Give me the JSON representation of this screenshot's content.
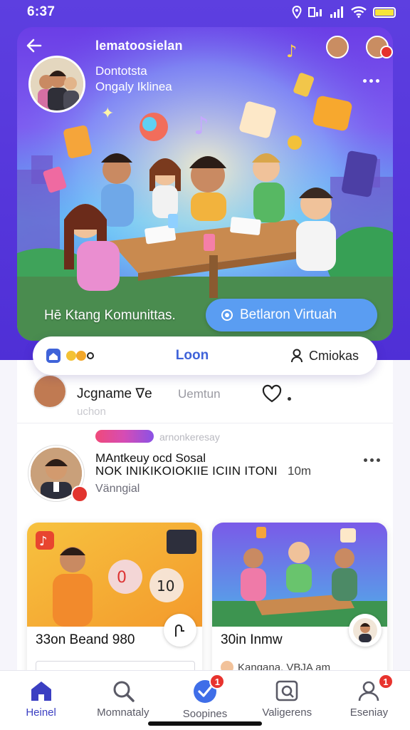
{
  "status": {
    "time": "6:37"
  },
  "hero": {
    "title": "lematoosielan",
    "subtitle_1": "Dontotsta",
    "subtitle_2": "Ongaly Iklinea",
    "caption": "Hē Ktang Komunittas.",
    "virtual_button": "Betlaron Virtuah"
  },
  "pillbar": {
    "left_label": "●●●",
    "center_label": "Loon",
    "right_label": "Cmiokas"
  },
  "feed": {
    "row1": {
      "name": "Jcgname ∇e",
      "meta": "Uemtun",
      "faded": "uchon"
    },
    "row2": {
      "tag": "arnonkeresay",
      "line1": "MAntkeuy ocd Sosal",
      "line2": "NOK INIKIKOIOKIIE ICIIN ITONI",
      "time": "10m",
      "line3": "Vänngial"
    }
  },
  "cards": [
    {
      "title": "33on Beand 980"
    },
    {
      "title": "30in Inmw",
      "sub": "Kangana. VBJA am"
    }
  ],
  "nav": [
    {
      "label": "Heinel"
    },
    {
      "label": "Momnataly"
    },
    {
      "label": "Soopines",
      "badge": "1"
    },
    {
      "label": "Valigerens"
    },
    {
      "label": "Eseniay",
      "badge": "1"
    }
  ],
  "colors": {
    "brand_purple": "#5d3fe0",
    "accent_blue": "#3f63d9",
    "badge_red": "#e8332e"
  }
}
